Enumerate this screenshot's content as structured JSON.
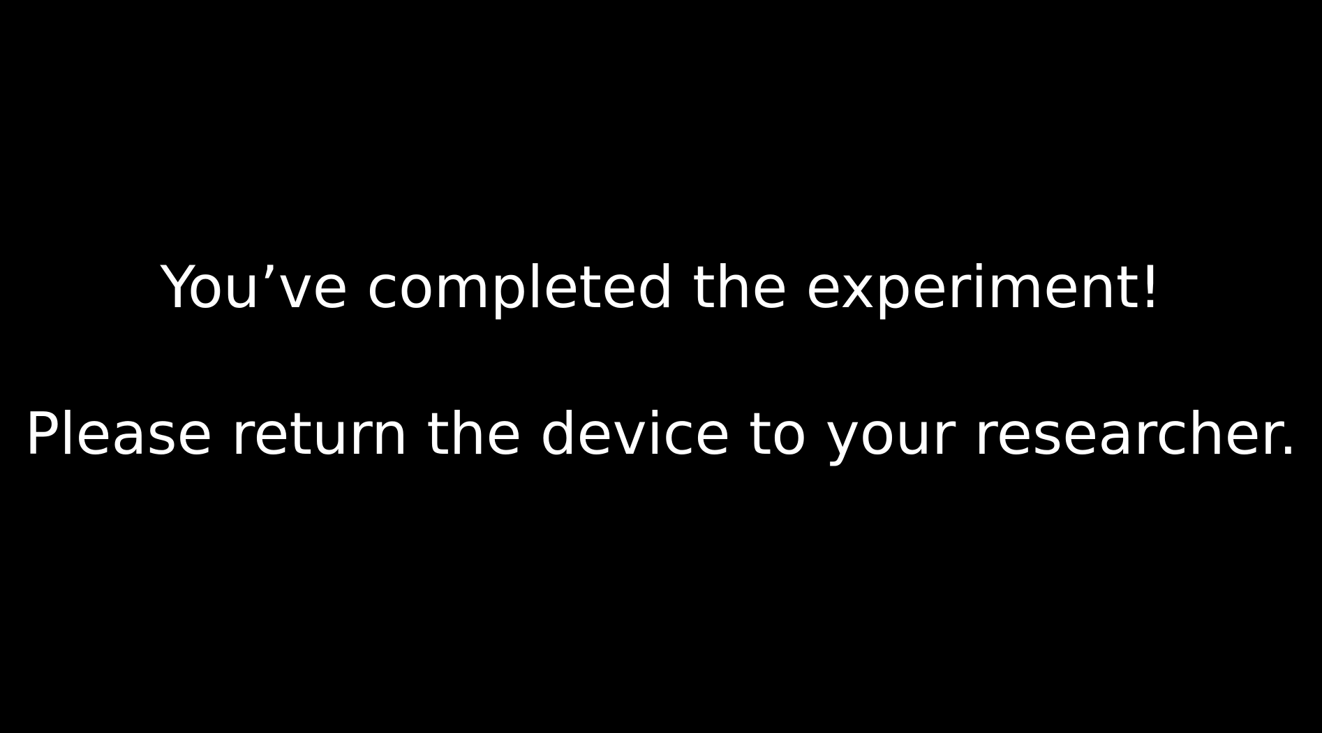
{
  "message": {
    "line1": "You’ve completed the experiment!",
    "line2": "Please return the device to your researcher."
  },
  "colors": {
    "background": "#000000",
    "text": "#ffffff"
  }
}
